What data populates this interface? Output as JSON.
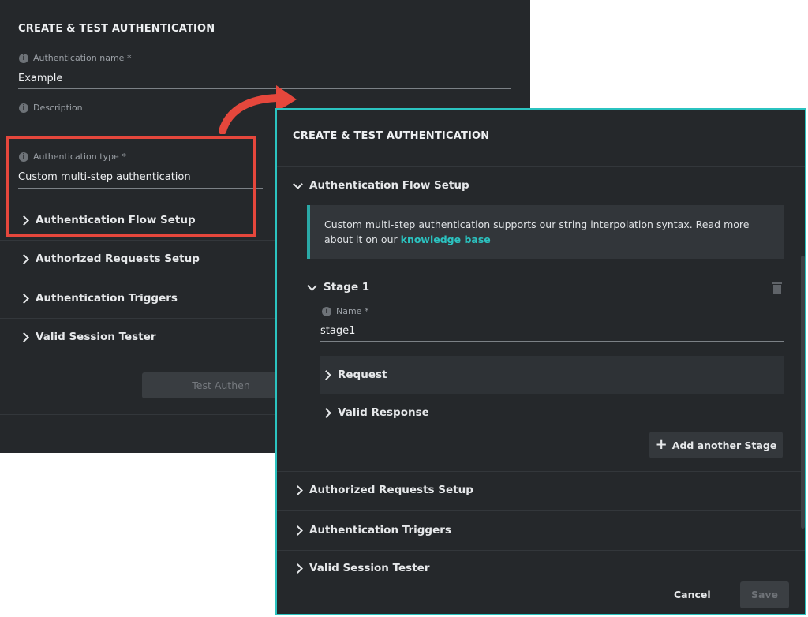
{
  "back_dialog": {
    "title": "CREATE & TEST AUTHENTICATION",
    "name_label": "Authentication name *",
    "name_value": "Example",
    "description_label": "Description",
    "type_label": "Authentication type *",
    "type_value": "Custom multi-step authentication",
    "sections": [
      "Authentication Flow Setup",
      "Authorized Requests Setup",
      "Authentication Triggers",
      "Valid Session Tester"
    ],
    "test_button": "Test Authen"
  },
  "front_dialog": {
    "title": "CREATE & TEST AUTHENTICATION",
    "flow_section": "Authentication Flow Setup",
    "info_text": "Custom multi-step authentication supports our string interpolation syntax. Read more about it on our ",
    "info_link": "knowledge base",
    "stage_title": "Stage 1",
    "stage_name_label": "Name *",
    "stage_name_value": "stage1",
    "request_label": "Request",
    "valid_response_label": "Valid Response",
    "add_stage_button": "Add another Stage",
    "sections": [
      "Authorized Requests Setup",
      "Authentication Triggers",
      "Valid Session Tester"
    ],
    "cancel_button": "Cancel",
    "save_button": "Save"
  },
  "colors": {
    "panel_bg": "#25282b",
    "accent_teal": "#2bc3c0",
    "highlight_red": "#e5473c"
  },
  "icons": [
    "info-icon",
    "chevron-right-icon",
    "chevron-down-icon",
    "trash-icon",
    "plus-icon",
    "curved-arrow-icon"
  ]
}
